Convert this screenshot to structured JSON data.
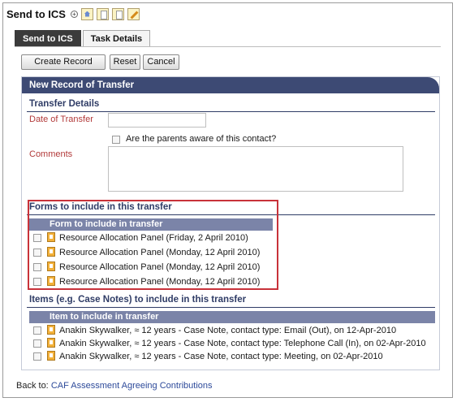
{
  "header": {
    "title": "Send to ICS"
  },
  "tabs": [
    {
      "label": "Send to ICS"
    },
    {
      "label": "Task Details"
    }
  ],
  "actions": {
    "create": "Create Record",
    "reset": "Reset",
    "cancel": "Cancel"
  },
  "panel": {
    "title": "New Record of Transfer"
  },
  "transfer": {
    "title": "Transfer Details",
    "date_label": "Date of Transfer",
    "date_value": "",
    "parents_aware_label": "Are the parents aware of this contact?",
    "comments_label": "Comments",
    "comments_value": ""
  },
  "forms": {
    "title": "Forms to include in this transfer",
    "column": "Form to include in transfer",
    "rows": [
      "Resource Allocation Panel (Friday, 2 April 2010)",
      "Resource Allocation Panel (Monday, 12 April 2010)",
      "Resource Allocation Panel (Monday, 12 April 2010)",
      "Resource Allocation Panel (Monday, 12 April 2010)"
    ]
  },
  "items": {
    "title": "Items (e.g. Case Notes) to include in this transfer",
    "column": "Item to include in transfer",
    "rows": [
      "Anakin Skywalker, ≈ 12 years - Case Note, contact type: Email (Out), on 12-Apr-2010",
      "Anakin Skywalker, ≈ 12 years - Case Note, contact type: Telephone Call (In), on 02-Apr-2010",
      "Anakin Skywalker, ≈ 12 years - Case Note, contact type: Meeting, on 02-Apr-2010"
    ]
  },
  "footer": {
    "back_label": "Back to:",
    "back_link": "CAF Assessment Agreeing Contributions"
  },
  "colors": {
    "panel_header": "#3d4a74",
    "section_title": "#2f3c66",
    "field_label": "#b23a3a",
    "grid_header": "#7b84a8",
    "highlight": "#c8323a",
    "active_tab": "#3b3b3b"
  }
}
